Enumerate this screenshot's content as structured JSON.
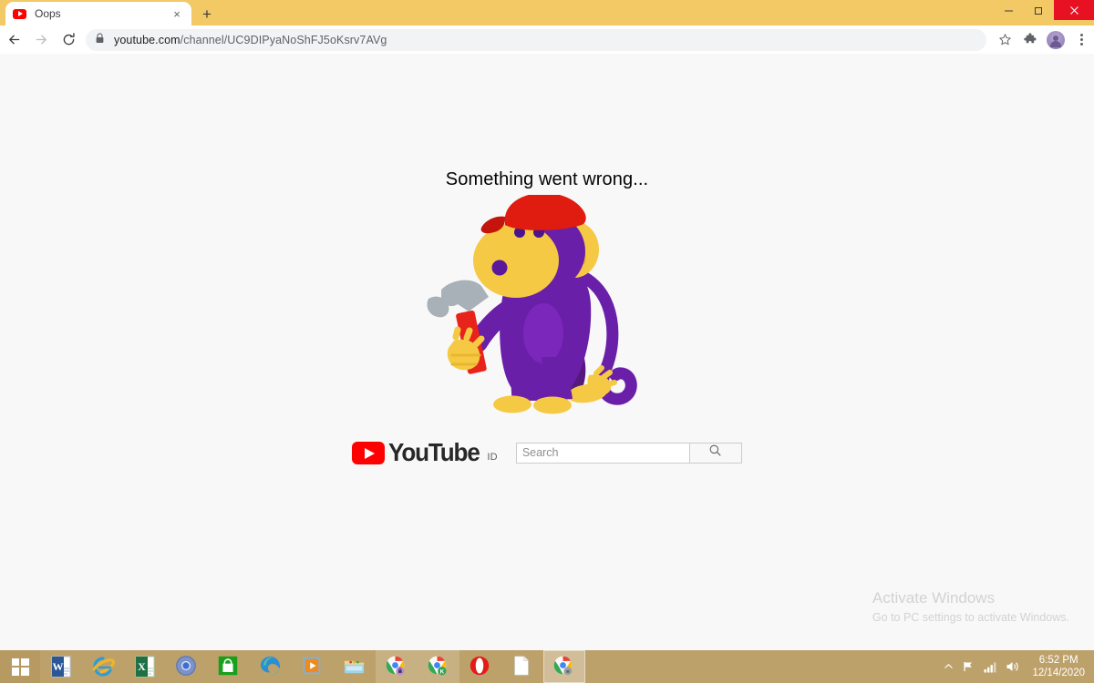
{
  "browser": {
    "theme_color": "#f2c964",
    "tab": {
      "title": "Oops",
      "favicon": "youtube-favicon",
      "close_label": "×"
    },
    "new_tab_label": "+",
    "window_controls": {
      "minimize": "─",
      "maximize": "❐",
      "close": "✕"
    },
    "toolbar": {
      "back_icon": "back-arrow-icon",
      "forward_icon": "forward-arrow-icon",
      "reload_icon": "reload-icon",
      "lock_icon": "lock-icon",
      "url_host": "youtube.com",
      "url_path": "/channel/UC9DIPyaNoShFJ5oKsrv7AVg",
      "url_full": "youtube.com/channel/UC9DIPyaNoShFJ5oKsrv7AVg",
      "bookmark_icon": "star-icon",
      "extensions_icon": "puzzle-piece-icon",
      "profile_icon": "avatar-icon",
      "menu_icon": "kebab-menu-icon"
    }
  },
  "page": {
    "background": "#f8f8f8",
    "error_title": "Something went wrong...",
    "illustration": {
      "name": "monkey-with-hammer",
      "colors": {
        "body": "#6a1fa8",
        "body_light": "#8d2fc9",
        "fur": "#f5c944",
        "cap": "#e01b10",
        "hammer_head": "#a8b0b8",
        "hammer_handle": "#e8231a"
      }
    },
    "brand": {
      "logo_word": "YouTube",
      "country_code": "ID",
      "play_icon": "youtube-play-icon"
    },
    "search": {
      "placeholder": "Search",
      "value": "",
      "button_icon": "search-icon"
    },
    "watermark": {
      "title": "Activate Windows",
      "subtitle": "Go to PC settings to activate Windows.",
      "color": "#d2d2d2"
    }
  },
  "taskbar": {
    "background": "#bda16a",
    "start_label": "start-button",
    "items": [
      {
        "name": "word",
        "label": "Microsoft Word",
        "state": "pinned"
      },
      {
        "name": "internet-explorer",
        "label": "Internet Explorer",
        "state": "pinned"
      },
      {
        "name": "excel",
        "label": "Microsoft Excel",
        "state": "pinned"
      },
      {
        "name": "chromium",
        "label": "Chromium",
        "state": "pinned"
      },
      {
        "name": "microsoft-store",
        "label": "Microsoft Store",
        "state": "pinned"
      },
      {
        "name": "edge",
        "label": "Microsoft Edge",
        "state": "pinned"
      },
      {
        "name": "media-player",
        "label": "Media Player",
        "state": "pinned"
      },
      {
        "name": "file-explorer",
        "label": "File Explorer",
        "state": "pinned"
      },
      {
        "name": "chrome-locked",
        "label": "Chrome",
        "state": "running"
      },
      {
        "name": "chrome-k",
        "label": "Chrome",
        "state": "running"
      },
      {
        "name": "opera",
        "label": "Opera",
        "state": "pinned"
      },
      {
        "name": "document",
        "label": "Document",
        "state": "pinned"
      },
      {
        "name": "chrome-active",
        "label": "Google Chrome",
        "state": "active"
      }
    ],
    "tray": {
      "overflow_icon": "chevron-up-icon",
      "network_icon": "network-flag-icon",
      "signal_icon": "signal-bars-icon",
      "volume_icon": "speaker-icon",
      "time": "6:52 PM",
      "date": "12/14/2020"
    }
  }
}
